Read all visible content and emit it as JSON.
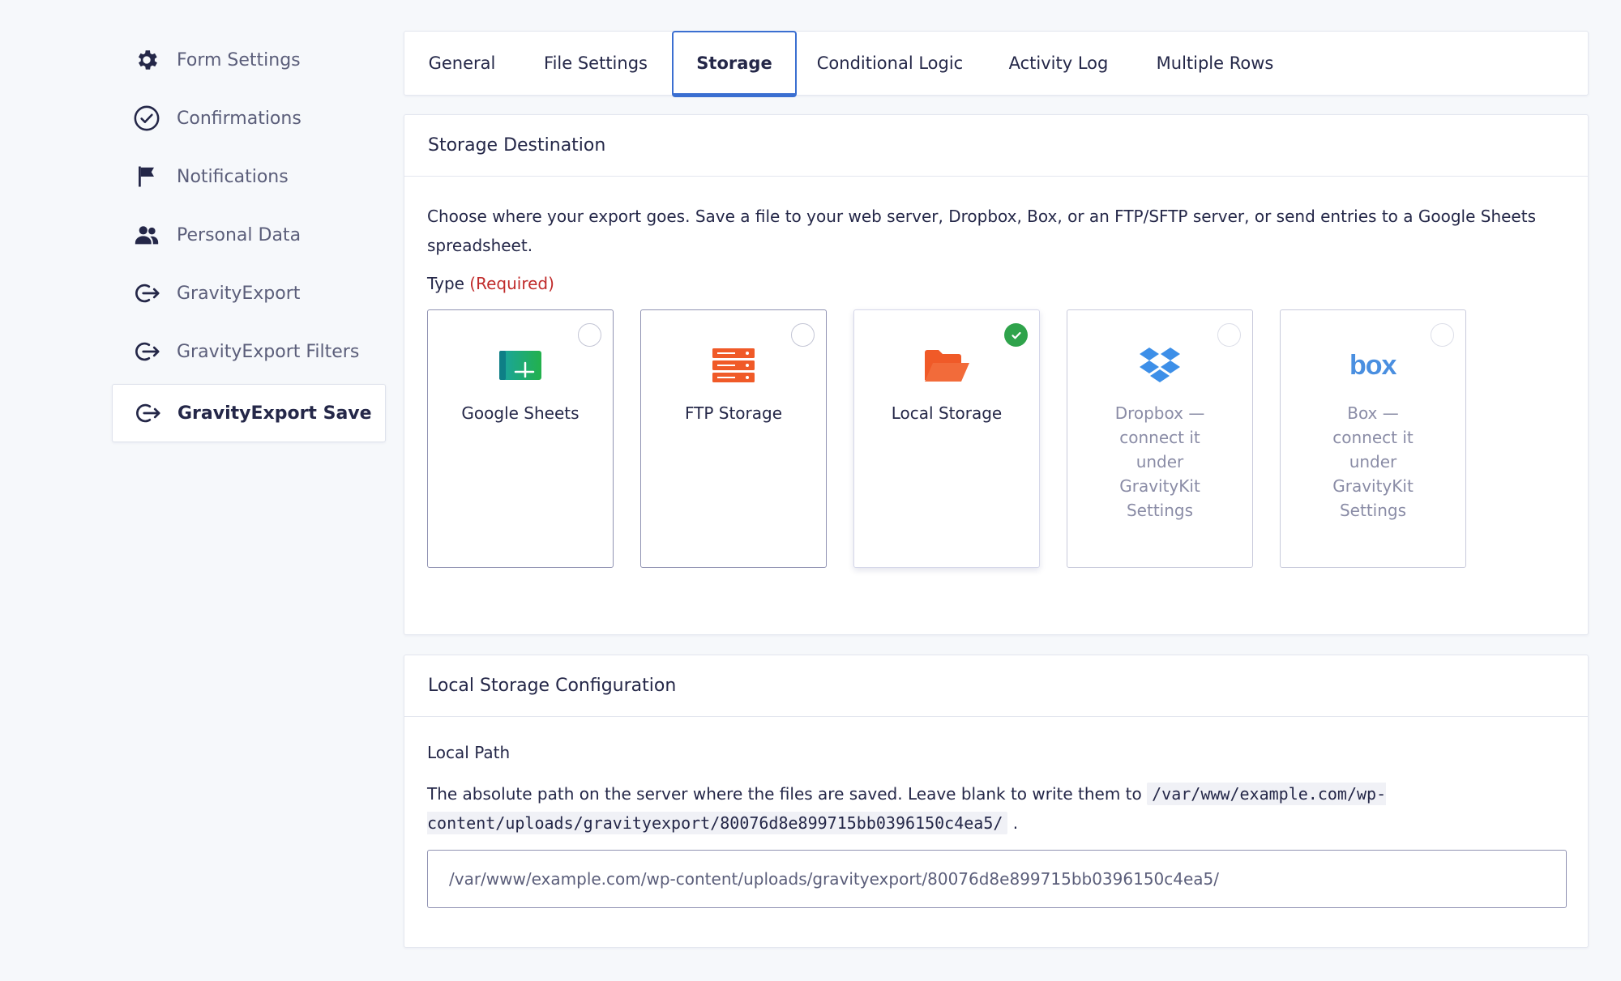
{
  "sidebar": {
    "items": [
      {
        "label": "Form Settings",
        "icon": "gear-icon"
      },
      {
        "label": "Confirmations",
        "icon": "check-circle-icon"
      },
      {
        "label": "Notifications",
        "icon": "flag-icon"
      },
      {
        "label": "Personal Data",
        "icon": "users-icon"
      },
      {
        "label": "GravityExport",
        "icon": "export-icon"
      },
      {
        "label": "GravityExport Filters",
        "icon": "export-icon"
      },
      {
        "label": "GravityExport Save",
        "icon": "export-icon",
        "active": true
      }
    ]
  },
  "tabs": [
    {
      "label": "General"
    },
    {
      "label": "File Settings"
    },
    {
      "label": "Storage",
      "active": true
    },
    {
      "label": "Conditional Logic"
    },
    {
      "label": "Activity Log"
    },
    {
      "label": "Multiple Rows"
    }
  ],
  "storage": {
    "title": "Storage Destination",
    "description": "Choose where your export goes. Save a file to your web server, Dropbox, Box, or an FTP/SFTP server, or send entries to a Google Sheets spreadsheet.",
    "type_label": "Type",
    "required_label": "(Required)",
    "options": [
      {
        "label": "Google Sheets",
        "icon": "google-sheets-icon",
        "selected": false,
        "disabled": false
      },
      {
        "label": "FTP Storage",
        "icon": "server-icon",
        "selected": false,
        "disabled": false
      },
      {
        "label": "Local Storage",
        "icon": "folder-open-icon",
        "selected": true,
        "disabled": false
      },
      {
        "label": "Dropbox — connect it under GravityKit Settings",
        "icon": "dropbox-icon",
        "selected": false,
        "disabled": true
      },
      {
        "label": "Box — connect it under GravityKit Settings",
        "icon": "box-icon",
        "selected": false,
        "disabled": true
      }
    ]
  },
  "local": {
    "title": "Local Storage Configuration",
    "field_label": "Local Path",
    "description_prefix": "The absolute path on the server where the files are saved. Leave blank to write them to",
    "default_path": "/var/www/example.com/wp-content/uploads/gravityexport/80076d8e899715bb0396150c4ea5/",
    "description_suffix": ".",
    "input_value": "/var/www/example.com/wp-content/uploads/gravityexport/80076d8e899715bb0396150c4ea5/"
  },
  "colors": {
    "accent": "#3b6fd1",
    "required": "#c02b2b",
    "checked": "#2fa34b",
    "ftp_orange": "#f05a28",
    "dropbox_blue": "#3d8fe8",
    "box_blue": "#4a8fe0",
    "sheets_green": "#1ea362"
  }
}
